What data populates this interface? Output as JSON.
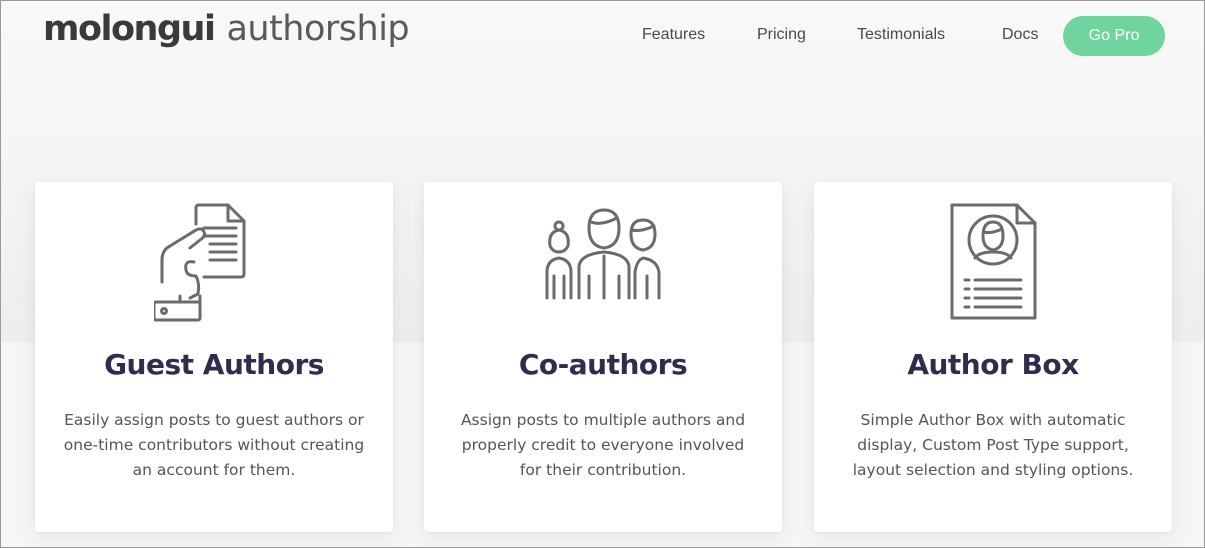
{
  "header": {
    "logo_bold": "molongui",
    "logo_light": "authorship",
    "nav": [
      {
        "label": "Features"
      },
      {
        "label": "Pricing"
      },
      {
        "label": "Testimonials"
      },
      {
        "label": "Docs"
      }
    ],
    "cta_label": "Go Pro",
    "cta_color": "#6fd49e"
  },
  "features": [
    {
      "icon": "hand-holding-document-icon",
      "title": "Guest Authors",
      "desc_lines": [
        "Easily assign posts to guest authors or",
        "one-time contributors without creating",
        "an account for them."
      ]
    },
    {
      "icon": "group-of-people-icon",
      "title": "Co-authors",
      "desc_lines": [
        "Assign posts to multiple authors and",
        "properly credit to everyone involved",
        "for their contribution."
      ]
    },
    {
      "icon": "profile-document-icon",
      "title": "Author Box",
      "desc_lines": [
        "Simple Author Box with automatic",
        "display, Custom Post Type support,",
        "layout selection and styling options."
      ]
    }
  ],
  "colors": {
    "title": "#2e2d4d",
    "text": "#555555",
    "icon": "#6b6b6b"
  }
}
